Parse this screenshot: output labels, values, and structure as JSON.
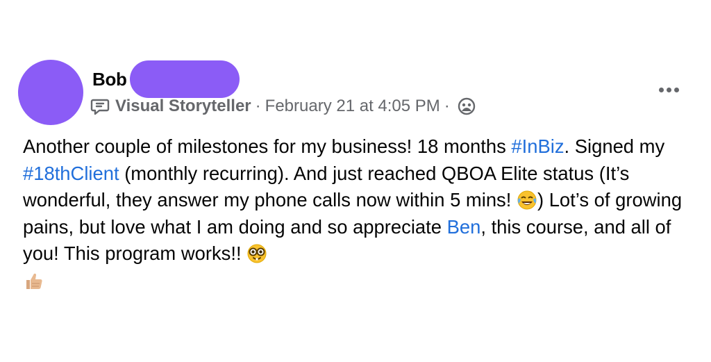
{
  "author": {
    "name": "Bob"
  },
  "meta": {
    "badge_icon": "chat-bubble-icon",
    "badge_label": "Visual Storyteller",
    "separator": "·",
    "date": "February 21 at 4:05 PM",
    "separator2": "·",
    "audience_icon": "group-icon"
  },
  "more_icon": "more-options-icon",
  "post": {
    "t1": "Another couple of milestones for my business! 18 months ",
    "hashtag1": "#InBiz",
    "t2": ". Signed my ",
    "hashtag2": "#18thClient",
    "t3": " (monthly recurring). And just reached QBOA Elite status (It’s wonderful, they answer my phone calls now within 5 mins! ",
    "emoji1": "crying-laughing-emoji",
    "t4": ") Lot’s of growing pains, but love what I am doing and so appreciate ",
    "mention": "Ben",
    "t5": ", this course, and all of you! This program works!! ",
    "emoji2": "nerd-face-emoji",
    "emoji3": "thumbs-up-emoji"
  },
  "colors": {
    "avatar": "#8b5cf6",
    "link": "#216fdb",
    "meta_text": "#65676b"
  }
}
